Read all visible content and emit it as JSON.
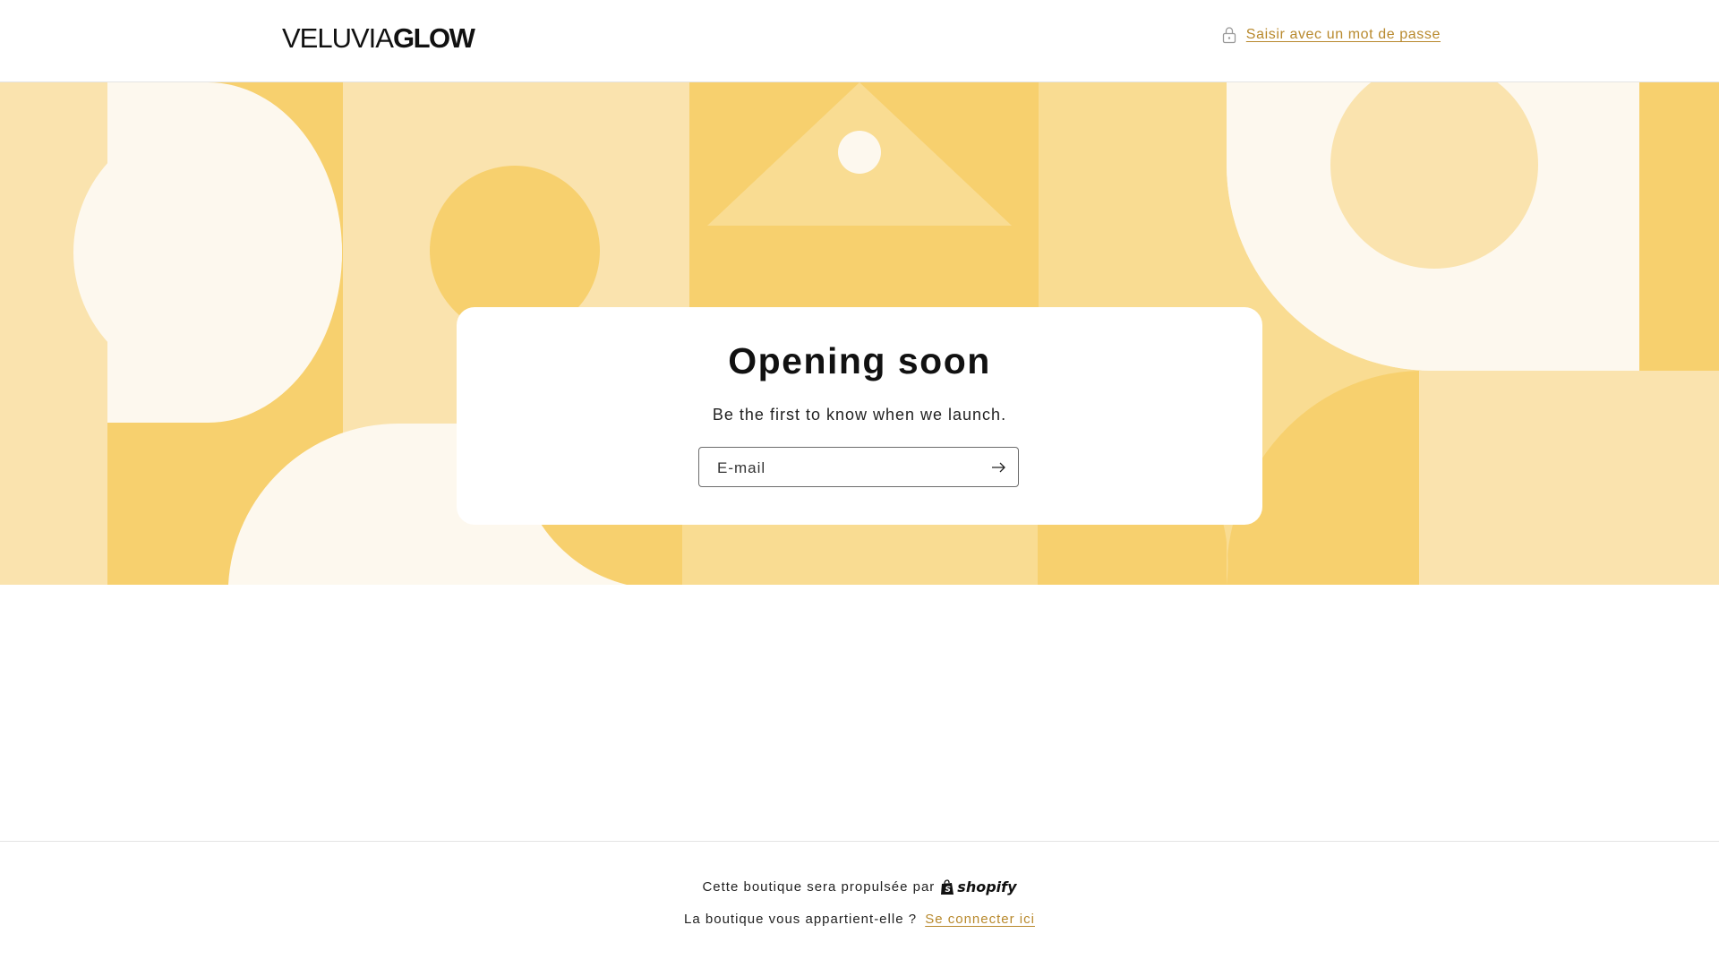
{
  "header": {
    "logo_light": "VELUVIA",
    "logo_bold": "GLOW",
    "password_link": "Saisir avec un mot de passe"
  },
  "card": {
    "title": "Opening soon",
    "subtitle": "Be the first to know when we launch.",
    "email_placeholder": "E-mail"
  },
  "footer": {
    "powered_by": "Cette boutique sera propulsée par",
    "shopify_brand": "shopify",
    "owner_question": "La boutique vous appartient-elle ?",
    "login_link": "Se connecter ici"
  },
  "colors": {
    "accent": "#b8892d",
    "yellow_dark": "#f7d06e",
    "yellow_mid": "#f9dc92",
    "yellow_light": "#fae3ae",
    "cream": "#fdf8ee"
  }
}
